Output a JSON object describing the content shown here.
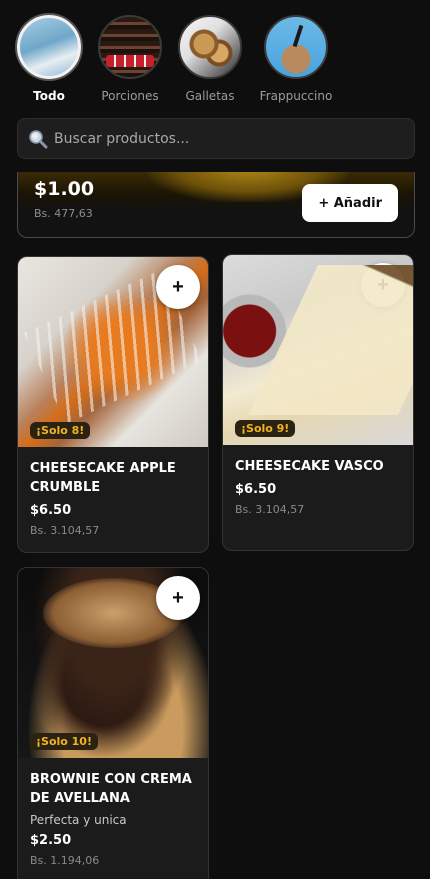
{
  "categories": [
    {
      "label": "Todo",
      "icon": "cake-photo-icon",
      "active": true
    },
    {
      "label": "Porciones",
      "icon": "brownie-photo-icon",
      "active": false
    },
    {
      "label": "Galletas",
      "icon": "cookies-photo-icon",
      "active": false
    },
    {
      "label": "Frappuccino",
      "icon": "frappuccino-photo-icon",
      "active": false
    }
  ],
  "search": {
    "placeholder": "Buscar productos...",
    "icon": "search-icon"
  },
  "top_card": {
    "price": "$1.00",
    "bs_price": "Bs. 477,63",
    "add_label": "+ Añadir"
  },
  "products": [
    {
      "title": "CHEESECAKE APPLE CRUMBLE",
      "badge": "¡Solo 8!",
      "price": "$6.50",
      "bs_price": "Bs. 3.104,57",
      "plus": "+"
    },
    {
      "title": "CHEESECAKE VASCO",
      "badge": "¡Solo 9!",
      "price": "$6.50",
      "bs_price": "Bs. 3.104,57",
      "plus": "+"
    },
    {
      "title": "BROWNIE CON CREMA DE AVELLANA",
      "badge": "¡Solo 10!",
      "description": "Perfecta y unica",
      "price": "$2.50",
      "bs_price": "Bs. 1.194,06",
      "plus": "+"
    }
  ],
  "colors": {
    "background": "#0e0e0e",
    "card": "#1b1b1b",
    "badge_text": "#f2b321"
  }
}
